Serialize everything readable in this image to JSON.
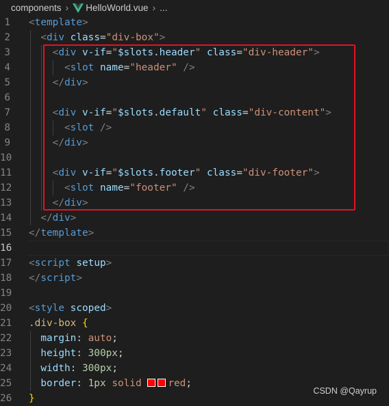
{
  "breadcrumb": {
    "folder": "components",
    "file": "HelloWorld.vue",
    "more": "..."
  },
  "colors": {
    "highlight_box": "#e81123",
    "vue_icon": "#41b883",
    "color_swatch": "#ff0000"
  },
  "editor": {
    "current_line": 16,
    "lines": [
      {
        "n": "1",
        "tokens": [
          [
            "t-punc",
            "<"
          ],
          [
            "t-tag",
            "template"
          ],
          [
            "t-punc",
            ">"
          ]
        ]
      },
      {
        "n": "2",
        "tokens": [
          [
            "t-txt",
            "  "
          ],
          [
            "t-punc",
            "<"
          ],
          [
            "t-tag",
            "div"
          ],
          [
            "t-txt",
            " "
          ],
          [
            "t-attr",
            "class"
          ],
          [
            "t-txt",
            "="
          ],
          [
            "t-str",
            "\"div-box\""
          ],
          [
            "t-punc",
            ">"
          ]
        ]
      },
      {
        "n": "3",
        "tokens": [
          [
            "t-txt",
            "    "
          ],
          [
            "t-punc",
            "<"
          ],
          [
            "t-tag",
            "div"
          ],
          [
            "t-txt",
            " "
          ],
          [
            "t-attr",
            "v-if"
          ],
          [
            "t-txt",
            "="
          ],
          [
            "t-str",
            "\""
          ],
          [
            "t-attr",
            "$slots"
          ],
          [
            "t-txt",
            "."
          ],
          [
            "t-attr",
            "header"
          ],
          [
            "t-str",
            "\""
          ],
          [
            "t-txt",
            " "
          ],
          [
            "t-attr",
            "class"
          ],
          [
            "t-txt",
            "="
          ],
          [
            "t-str",
            "\"div-header\""
          ],
          [
            "t-punc",
            ">"
          ]
        ]
      },
      {
        "n": "4",
        "tokens": [
          [
            "t-txt",
            "      "
          ],
          [
            "t-punc",
            "<"
          ],
          [
            "t-tag",
            "slot"
          ],
          [
            "t-txt",
            " "
          ],
          [
            "t-attr",
            "name"
          ],
          [
            "t-txt",
            "="
          ],
          [
            "t-str",
            "\"header\""
          ],
          [
            "t-txt",
            " "
          ],
          [
            "t-punc",
            "/>"
          ]
        ]
      },
      {
        "n": "5",
        "tokens": [
          [
            "t-txt",
            "    "
          ],
          [
            "t-punc",
            "</"
          ],
          [
            "t-tag",
            "div"
          ],
          [
            "t-punc",
            ">"
          ]
        ]
      },
      {
        "n": "6",
        "tokens": []
      },
      {
        "n": "7",
        "tokens": [
          [
            "t-txt",
            "    "
          ],
          [
            "t-punc",
            "<"
          ],
          [
            "t-tag",
            "div"
          ],
          [
            "t-txt",
            " "
          ],
          [
            "t-attr",
            "v-if"
          ],
          [
            "t-txt",
            "="
          ],
          [
            "t-str",
            "\""
          ],
          [
            "t-attr",
            "$slots"
          ],
          [
            "t-txt",
            "."
          ],
          [
            "t-attr",
            "default"
          ],
          [
            "t-str",
            "\""
          ],
          [
            "t-txt",
            " "
          ],
          [
            "t-attr",
            "class"
          ],
          [
            "t-txt",
            "="
          ],
          [
            "t-str",
            "\"div-content\""
          ],
          [
            "t-punc",
            ">"
          ]
        ]
      },
      {
        "n": "8",
        "tokens": [
          [
            "t-txt",
            "      "
          ],
          [
            "t-punc",
            "<"
          ],
          [
            "t-tag",
            "slot"
          ],
          [
            "t-txt",
            " "
          ],
          [
            "t-punc",
            "/>"
          ]
        ]
      },
      {
        "n": "9",
        "tokens": [
          [
            "t-txt",
            "    "
          ],
          [
            "t-punc",
            "</"
          ],
          [
            "t-tag",
            "div"
          ],
          [
            "t-punc",
            ">"
          ]
        ]
      },
      {
        "n": "10",
        "tokens": []
      },
      {
        "n": "11",
        "tokens": [
          [
            "t-txt",
            "    "
          ],
          [
            "t-punc",
            "<"
          ],
          [
            "t-tag",
            "div"
          ],
          [
            "t-txt",
            " "
          ],
          [
            "t-attr",
            "v-if"
          ],
          [
            "t-txt",
            "="
          ],
          [
            "t-str",
            "\""
          ],
          [
            "t-attr",
            "$slots"
          ],
          [
            "t-txt",
            "."
          ],
          [
            "t-attr",
            "footer"
          ],
          [
            "t-str",
            "\""
          ],
          [
            "t-txt",
            " "
          ],
          [
            "t-attr",
            "class"
          ],
          [
            "t-txt",
            "="
          ],
          [
            "t-str",
            "\"div-footer\""
          ],
          [
            "t-punc",
            ">"
          ]
        ]
      },
      {
        "n": "12",
        "tokens": [
          [
            "t-txt",
            "      "
          ],
          [
            "t-punc",
            "<"
          ],
          [
            "t-tag",
            "slot"
          ],
          [
            "t-txt",
            " "
          ],
          [
            "t-attr",
            "name"
          ],
          [
            "t-txt",
            "="
          ],
          [
            "t-str",
            "\"footer\""
          ],
          [
            "t-txt",
            " "
          ],
          [
            "t-punc",
            "/>"
          ]
        ]
      },
      {
        "n": "13",
        "tokens": [
          [
            "t-txt",
            "    "
          ],
          [
            "t-punc",
            "</"
          ],
          [
            "t-tag",
            "div"
          ],
          [
            "t-punc",
            ">"
          ]
        ]
      },
      {
        "n": "14",
        "tokens": [
          [
            "t-txt",
            "  "
          ],
          [
            "t-punc",
            "</"
          ],
          [
            "t-tag",
            "div"
          ],
          [
            "t-punc",
            ">"
          ]
        ]
      },
      {
        "n": "15",
        "tokens": [
          [
            "t-punc",
            "</"
          ],
          [
            "t-tag",
            "template"
          ],
          [
            "t-punc",
            ">"
          ]
        ]
      },
      {
        "n": "16",
        "tokens": []
      },
      {
        "n": "17",
        "tokens": [
          [
            "t-punc",
            "<"
          ],
          [
            "t-tag",
            "script"
          ],
          [
            "t-txt",
            " "
          ],
          [
            "t-attr",
            "setup"
          ],
          [
            "t-punc",
            ">"
          ]
        ]
      },
      {
        "n": "18",
        "tokens": [
          [
            "t-punc",
            "</"
          ],
          [
            "t-tag",
            "script"
          ],
          [
            "t-punc",
            ">"
          ]
        ]
      },
      {
        "n": "19",
        "tokens": []
      },
      {
        "n": "20",
        "tokens": [
          [
            "t-punc",
            "<"
          ],
          [
            "t-tag",
            "style"
          ],
          [
            "t-txt",
            " "
          ],
          [
            "t-attr",
            "scoped"
          ],
          [
            "t-punc",
            ">"
          ]
        ]
      },
      {
        "n": "21",
        "tokens": [
          [
            "t-sel",
            ".div-box"
          ],
          [
            "t-txt",
            " "
          ],
          [
            "t-brace",
            "{"
          ]
        ]
      },
      {
        "n": "22",
        "tokens": [
          [
            "t-txt",
            "  "
          ],
          [
            "t-prop",
            "margin"
          ],
          [
            "t-txt",
            ": "
          ],
          [
            "t-val",
            "auto"
          ],
          [
            "t-txt",
            ";"
          ]
        ]
      },
      {
        "n": "23",
        "tokens": [
          [
            "t-txt",
            "  "
          ],
          [
            "t-prop",
            "height"
          ],
          [
            "t-txt",
            ": "
          ],
          [
            "t-num",
            "300px"
          ],
          [
            "t-txt",
            ";"
          ]
        ]
      },
      {
        "n": "24",
        "tokens": [
          [
            "t-txt",
            "  "
          ],
          [
            "t-prop",
            "width"
          ],
          [
            "t-txt",
            ": "
          ],
          [
            "t-num",
            "300px"
          ],
          [
            "t-txt",
            ";"
          ]
        ]
      },
      {
        "n": "25",
        "tokens": [
          [
            "t-txt",
            "  "
          ],
          [
            "t-prop",
            "border"
          ],
          [
            "t-txt",
            ": "
          ],
          [
            "t-num",
            "1px"
          ],
          [
            "t-txt",
            " "
          ],
          [
            "t-val",
            "solid"
          ],
          [
            "t-txt",
            " "
          ],
          [
            "swatch",
            ""
          ],
          [
            "swatch",
            ""
          ],
          [
            "t-val",
            "red"
          ],
          [
            "t-txt",
            ";"
          ]
        ]
      },
      {
        "n": "26",
        "tokens": [
          [
            "t-brace",
            "}"
          ]
        ]
      }
    ]
  },
  "watermark": "CSDN @Qayrup"
}
